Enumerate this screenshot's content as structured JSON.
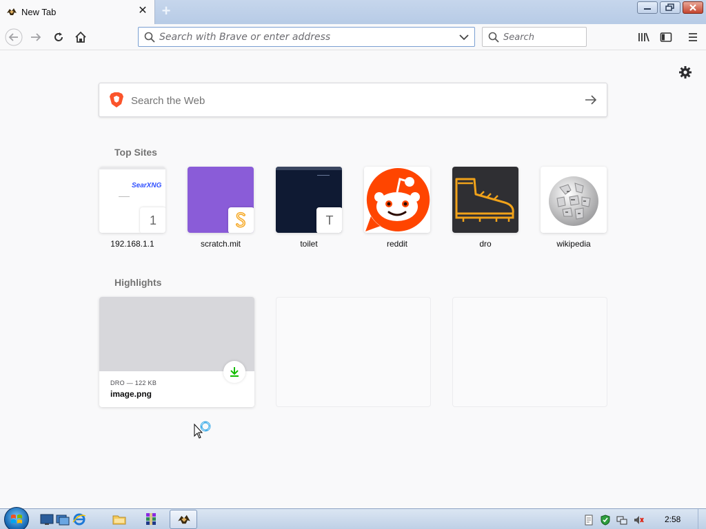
{
  "tab": {
    "title": "New Tab",
    "close": "✕",
    "new_tab": "+"
  },
  "toolbar": {
    "url_placeholder": "Search with Brave or enter address",
    "search_placeholder": "Search"
  },
  "content": {
    "web_search_placeholder": "Search the Web",
    "top_sites_title": "Top Sites",
    "highlights_title": "Highlights",
    "top_sites": [
      {
        "label": "192.168.1.1",
        "thumb_text": "SearXNG",
        "badge": "1"
      },
      {
        "label": "scratch.mit",
        "badge": "S"
      },
      {
        "label": "toilet",
        "badge": "T"
      },
      {
        "label": "reddit"
      },
      {
        "label": "dro"
      },
      {
        "label": "wikipedia"
      }
    ],
    "highlights": [
      {
        "meta": "DRO — 122 KB",
        "name": "image.png"
      }
    ]
  },
  "taskbar": {
    "clock": "2:58"
  },
  "colors": {
    "scratch": "#8a5cd8",
    "toilet": "#0f1a33",
    "reddit": "#ff4500",
    "dro": "#2f2f33",
    "download": "#12bc00"
  }
}
